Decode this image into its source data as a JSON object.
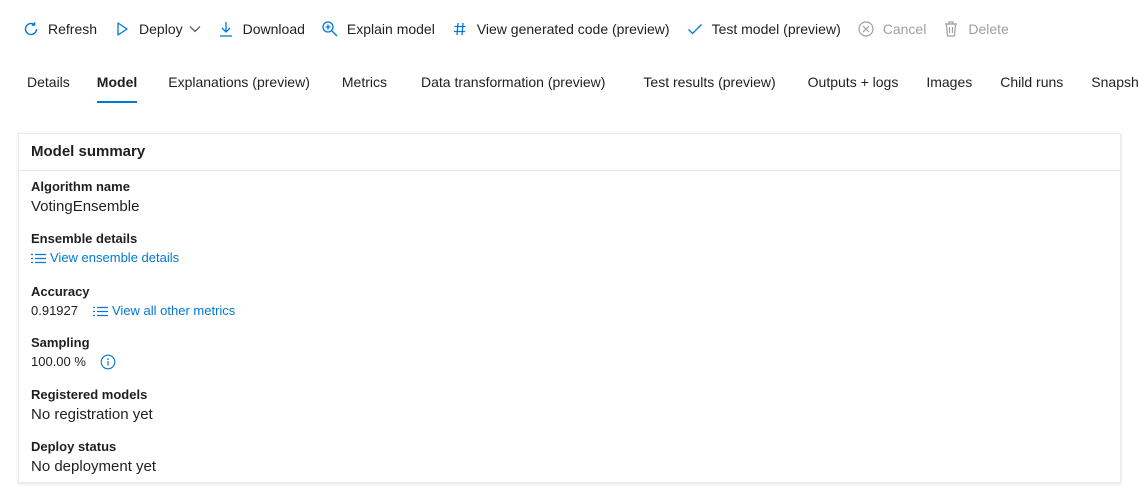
{
  "toolbar": {
    "refresh": {
      "label": "Refresh",
      "icon": "refresh-icon"
    },
    "deploy": {
      "label": "Deploy",
      "icon": "play-icon"
    },
    "download": {
      "label": "Download",
      "icon": "download-icon"
    },
    "explain": {
      "label": "Explain model",
      "icon": "zoom-in-icon"
    },
    "view_code": {
      "label": "View generated code (preview)",
      "icon": "hash-icon"
    },
    "test_model": {
      "label": "Test model (preview)",
      "icon": "checkmark-icon"
    },
    "cancel": {
      "label": "Cancel",
      "icon": "cancel-icon"
    },
    "delete": {
      "label": "Delete",
      "icon": "trash-icon"
    }
  },
  "tabs": [
    {
      "label": "Details",
      "active": false
    },
    {
      "label": "Model",
      "active": true
    },
    {
      "label": "Explanations (preview)",
      "active": false
    },
    {
      "label": "Metrics",
      "active": false
    },
    {
      "label": "Data transformation (preview)",
      "active": false
    },
    {
      "label": "Test results (preview)",
      "active": false
    },
    {
      "label": "Outputs + logs",
      "active": false
    },
    {
      "label": "Images",
      "active": false
    },
    {
      "label": "Child runs",
      "active": false
    },
    {
      "label": "Snapshot",
      "active": false
    }
  ],
  "summary": {
    "title": "Model summary",
    "algorithm": {
      "label": "Algorithm name",
      "value": "VotingEnsemble"
    },
    "ensemble": {
      "label": "Ensemble details",
      "link": "View ensemble details"
    },
    "accuracy": {
      "label": "Accuracy",
      "value": "0.91927",
      "link": "View all other metrics"
    },
    "sampling": {
      "label": "Sampling",
      "value": "100.00 %"
    },
    "registered": {
      "label": "Registered models",
      "value": "No registration yet"
    },
    "deploy_status": {
      "label": "Deploy status",
      "value": "No deployment yet"
    }
  },
  "colors": {
    "accent": "#0078d4",
    "disabled": "#a19f9d",
    "text": "#201f1e"
  }
}
